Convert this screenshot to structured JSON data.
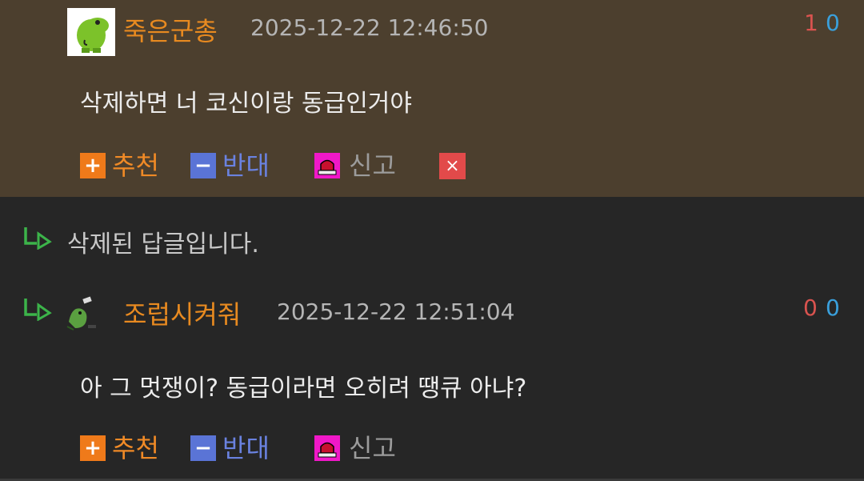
{
  "comment1": {
    "author": "죽은군총",
    "datetime": "2025-12-22 12:46:50",
    "up_count": "1",
    "down_count": "0",
    "text": "삭제하면 너 코신이랑 동급인거야",
    "actions": {
      "recommend": "추천",
      "oppose": "반대",
      "report": "신고",
      "delete": "×"
    }
  },
  "deleted_reply": {
    "text": "삭제된 답글입니다."
  },
  "comment2": {
    "author": "조럽시켜줘",
    "datetime": "2025-12-22 12:51:04",
    "up_count": "0",
    "down_count": "0",
    "text": "아 그 멋쟁이? 동급이라면 오히려 땡큐 아냐?",
    "actions": {
      "recommend": "추천",
      "oppose": "반대",
      "report": "신고"
    }
  },
  "icons": {
    "plus": "+",
    "minus": "−",
    "reply": "reply-arrow-icon",
    "report": "siren-icon",
    "delete": "close-icon"
  },
  "colors": {
    "highlight_bg": "#4c3f2e",
    "page_bg": "#262626",
    "author": "#e88a20",
    "up": "#d9534f",
    "down": "#3aa0dc",
    "reply_arrow": "#3cb44a"
  }
}
